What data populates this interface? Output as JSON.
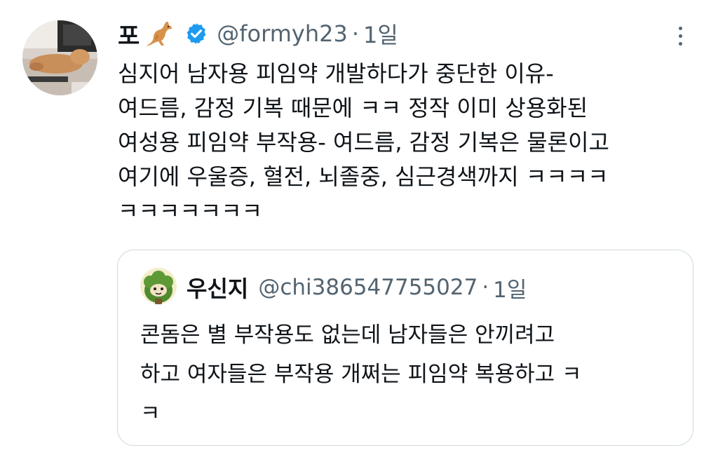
{
  "tweet": {
    "display_name": "포",
    "name_emoji_icon": "kangaroo-icon",
    "verified_icon": "verified-badge-icon",
    "handle": "@formyh23",
    "separator": "·",
    "time": "1일",
    "more_icon": "more-options-icon",
    "text_lines": [
      "심지어 남자용 피임약 개발하다가 중단한 이유-",
      "여드름, 감정 기복 때문에 ㅋㅋ 정작 이미 상용화된",
      "여성용 피임약 부작용- 여드름, 감정 기복은 물론이고",
      "여기에 우울증, 혈전, 뇌졸중, 심근경색까지 ㅋㅋㅋㅋ",
      "ㅋㅋㅋㅋㅋㅋㅋ"
    ]
  },
  "quote": {
    "display_name": "우신지",
    "handle": "@chi386547755027",
    "separator": "·",
    "time": "1일",
    "text_lines": [
      "콘돔은 별 부작용도 없는데 남자들은 안끼려고",
      "하고 여자들은 부작용 개쩌는 피임약 복용하고 ㅋ",
      "ㅋ"
    ]
  },
  "colors": {
    "text_primary": "#0f1419",
    "text_secondary": "#536471",
    "verified_blue": "#1d9bf0",
    "card_border": "#cfd9de"
  }
}
